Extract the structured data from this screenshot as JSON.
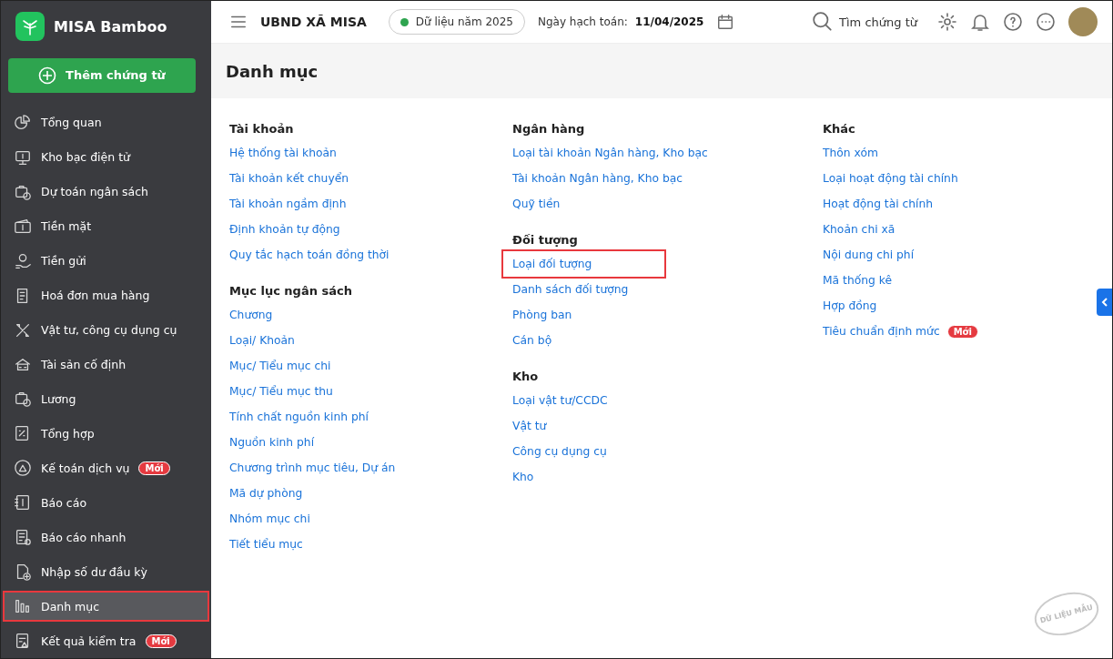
{
  "app": {
    "name": "MISA Bamboo",
    "new_button": "Thêm chứng từ"
  },
  "sidebar": {
    "items": [
      {
        "label": "Tổng quan",
        "selected": false,
        "highlighted": false
      },
      {
        "label": "Kho bạc điện tử",
        "selected": false,
        "highlighted": false
      },
      {
        "label": "Dự toán ngân sách",
        "selected": false,
        "highlighted": false
      },
      {
        "label": "Tiền mặt",
        "selected": false,
        "highlighted": false
      },
      {
        "label": "Tiền gửi",
        "selected": false,
        "highlighted": false
      },
      {
        "label": "Hoá đơn mua hàng",
        "selected": false,
        "highlighted": false
      },
      {
        "label": "Vật tư, công cụ dụng cụ",
        "selected": false,
        "highlighted": false
      },
      {
        "label": "Tài sản cố định",
        "selected": false,
        "highlighted": false
      },
      {
        "label": "Lương",
        "selected": false,
        "highlighted": false
      },
      {
        "label": "Tổng hợp",
        "selected": false,
        "highlighted": false
      },
      {
        "label": "Kế toán dịch vụ",
        "badge": "Mới",
        "selected": false,
        "highlighted": false
      },
      {
        "label": "Báo cáo",
        "selected": false,
        "highlighted": false
      },
      {
        "label": "Báo cáo nhanh",
        "selected": false,
        "highlighted": false
      },
      {
        "label": "Nhập số dư đầu kỳ",
        "selected": false,
        "highlighted": false
      },
      {
        "label": "Danh mục",
        "selected": true,
        "highlighted": true
      },
      {
        "label": "Kết quả kiểm tra",
        "badge": "Mới",
        "selected": false,
        "highlighted": false
      }
    ]
  },
  "header": {
    "org": "UBND XÃ MISA",
    "data_year": "Dữ liệu năm 2025",
    "date_label": "Ngày hạch toán:",
    "date": "11/04/2025",
    "search": "Tìm chứng từ"
  },
  "page_title": "Danh mục",
  "columns": [
    {
      "sections": [
        {
          "title": "Tài khoản",
          "links": [
            {
              "label": "Hệ thống tài khoản",
              "highlighted": false
            },
            {
              "label": "Tài khoản kết chuyển",
              "highlighted": false
            },
            {
              "label": "Tài khoản ngầm định",
              "highlighted": false
            },
            {
              "label": "Định khoản tự động",
              "highlighted": false
            },
            {
              "label": "Quy tắc hạch toán đồng thời",
              "highlighted": false
            }
          ]
        },
        {
          "title": "Mục lục ngân sách",
          "links": [
            {
              "label": "Chương",
              "highlighted": false
            },
            {
              "label": "Loại/ Khoản",
              "highlighted": false
            },
            {
              "label": "Mục/ Tiểu mục chi",
              "highlighted": false
            },
            {
              "label": "Mục/ Tiểu mục thu",
              "highlighted": false
            },
            {
              "label": "Tính chất nguồn kinh phí",
              "highlighted": false
            },
            {
              "label": "Nguồn kinh phí",
              "highlighted": false
            },
            {
              "label": "Chương trình mục tiêu, Dự án",
              "highlighted": false
            },
            {
              "label": "Mã dự phòng",
              "highlighted": false
            },
            {
              "label": "Nhóm mục chi",
              "highlighted": false
            },
            {
              "label": "Tiết tiểu mục",
              "highlighted": false
            }
          ]
        }
      ]
    },
    {
      "sections": [
        {
          "title": "Ngân hàng",
          "links": [
            {
              "label": "Loại tài khoản Ngân hàng, Kho bạc",
              "highlighted": false
            },
            {
              "label": "Tài khoản Ngân hàng, Kho bạc",
              "highlighted": false
            },
            {
              "label": "Quỹ tiền",
              "highlighted": false
            }
          ]
        },
        {
          "title": "Đối tượng",
          "links": [
            {
              "label": "Loại đối tượng",
              "highlighted": true
            },
            {
              "label": "Danh sách đối tượng",
              "highlighted": false
            },
            {
              "label": "Phòng ban",
              "highlighted": false
            },
            {
              "label": "Cán bộ",
              "highlighted": false
            }
          ]
        },
        {
          "title": "Kho",
          "links": [
            {
              "label": "Loại vật tư/CCDC",
              "highlighted": false
            },
            {
              "label": "Vật tư",
              "highlighted": false
            },
            {
              "label": "Công cụ dụng cụ",
              "highlighted": false
            },
            {
              "label": "Kho",
              "highlighted": false
            }
          ]
        }
      ]
    },
    {
      "sections": [
        {
          "title": "Khác",
          "links": [
            {
              "label": "Thôn xóm",
              "highlighted": false
            },
            {
              "label": "Loại hoạt động tài chính",
              "highlighted": false
            },
            {
              "label": "Hoạt động tài chính",
              "highlighted": false
            },
            {
              "label": "Khoản chi xã",
              "highlighted": false
            },
            {
              "label": "Nội dung chi phí",
              "highlighted": false
            },
            {
              "label": "Mã thống kê",
              "highlighted": false
            },
            {
              "label": "Hợp đồng",
              "highlighted": false
            },
            {
              "label": "Tiêu chuẩn định mức",
              "badge": "Mới",
              "highlighted": false
            }
          ]
        }
      ]
    }
  ],
  "stamp": "DỮ LIỆU MẪU"
}
